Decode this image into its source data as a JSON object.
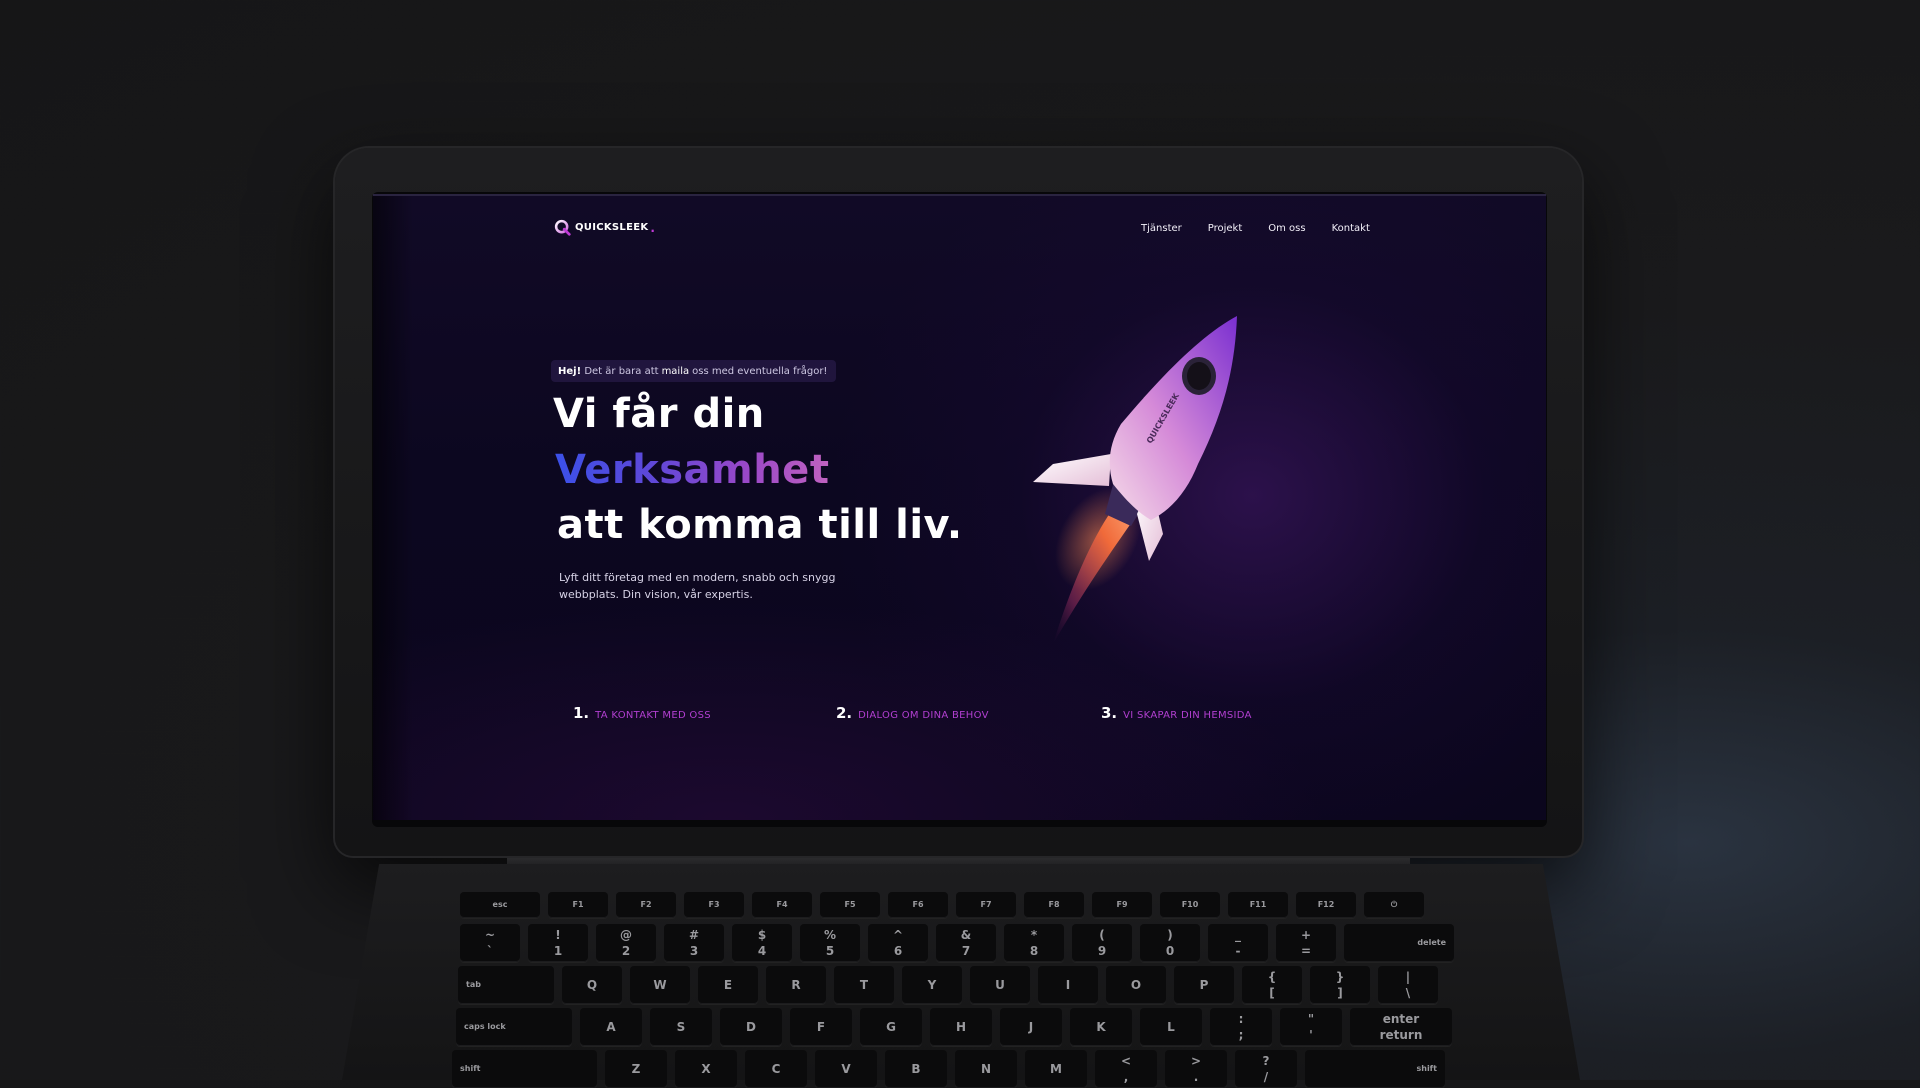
{
  "website": {
    "logo": {
      "text": "QUICKSLEEK",
      "dot": "."
    },
    "nav": {
      "items": [
        "Tjänster",
        "Projekt",
        "Om oss",
        "Kontakt"
      ]
    },
    "hero": {
      "pill": {
        "strong": "Hej!",
        "before": "Det är bara att",
        "emphasis": "maila",
        "after": "oss med eventuella frågor!"
      },
      "heading_line1": "Vi får din",
      "heading_line2": "Verksamhet",
      "heading_line3": "att komma till liv.",
      "lede": "Lyft ditt företag med en modern, snabb och snygg webbplats. Din vision, vår expertis."
    },
    "steps": [
      {
        "num": "1.",
        "label": "TA KONTAKT MED OSS"
      },
      {
        "num": "2.",
        "label": "DIALOG OM DINA BEHOV"
      },
      {
        "num": "3.",
        "label": "VI SKAPAR DIN HEMSIDA"
      }
    ],
    "rocket_text": "QUICKSLEEK",
    "colors": {
      "accent_purple": "#b13fd0",
      "gradient_start": "#3b50e8",
      "gradient_end": "#c062c0",
      "background": "#0c0720"
    }
  },
  "keyboard": {
    "fn_row": [
      "esc",
      "F1",
      "F2",
      "F3",
      "F4",
      "F5",
      "F6",
      "F7",
      "F8",
      "F9",
      "F10",
      "F11",
      "F12",
      "⏻"
    ],
    "number_row": [
      {
        "top": "~",
        "bottom": "`"
      },
      {
        "top": "!",
        "bottom": "1"
      },
      {
        "top": "@",
        "bottom": "2"
      },
      {
        "top": "#",
        "bottom": "3"
      },
      {
        "top": "$",
        "bottom": "4"
      },
      {
        "top": "%",
        "bottom": "5"
      },
      {
        "top": "^",
        "bottom": "6"
      },
      {
        "top": "&",
        "bottom": "7"
      },
      {
        "top": "*",
        "bottom": "8"
      },
      {
        "top": "(",
        "bottom": "9"
      },
      {
        "top": ")",
        "bottom": "0"
      },
      {
        "top": "_",
        "bottom": "-"
      },
      {
        "top": "+",
        "bottom": "="
      }
    ],
    "delete": "delete",
    "tab": "tab",
    "qwerty": [
      "Q",
      "W",
      "E",
      "R",
      "T",
      "Y",
      "U",
      "I",
      "O",
      "P"
    ],
    "brackets": [
      {
        "top": "{",
        "bottom": "["
      },
      {
        "top": "}",
        "bottom": "]"
      },
      {
        "top": "|",
        "bottom": "\\"
      }
    ],
    "caps_lock": "caps lock",
    "home_row": [
      "A",
      "S",
      "D",
      "F",
      "G",
      "H",
      "J",
      "K",
      "L"
    ],
    "home_punct": [
      {
        "top": ":",
        "bottom": ";"
      },
      {
        "top": "\"",
        "bottom": "'"
      }
    ],
    "enter": {
      "top": "enter",
      "bottom": "return"
    },
    "shift_left": "shift",
    "bottom_row": [
      "Z",
      "X",
      "C",
      "V",
      "B",
      "N",
      "M"
    ],
    "bottom_punct": [
      {
        "top": "<",
        "bottom": ","
      },
      {
        "top": ">",
        "bottom": "."
      },
      {
        "top": "?",
        "bottom": "/"
      }
    ],
    "shift_right": "shift"
  }
}
